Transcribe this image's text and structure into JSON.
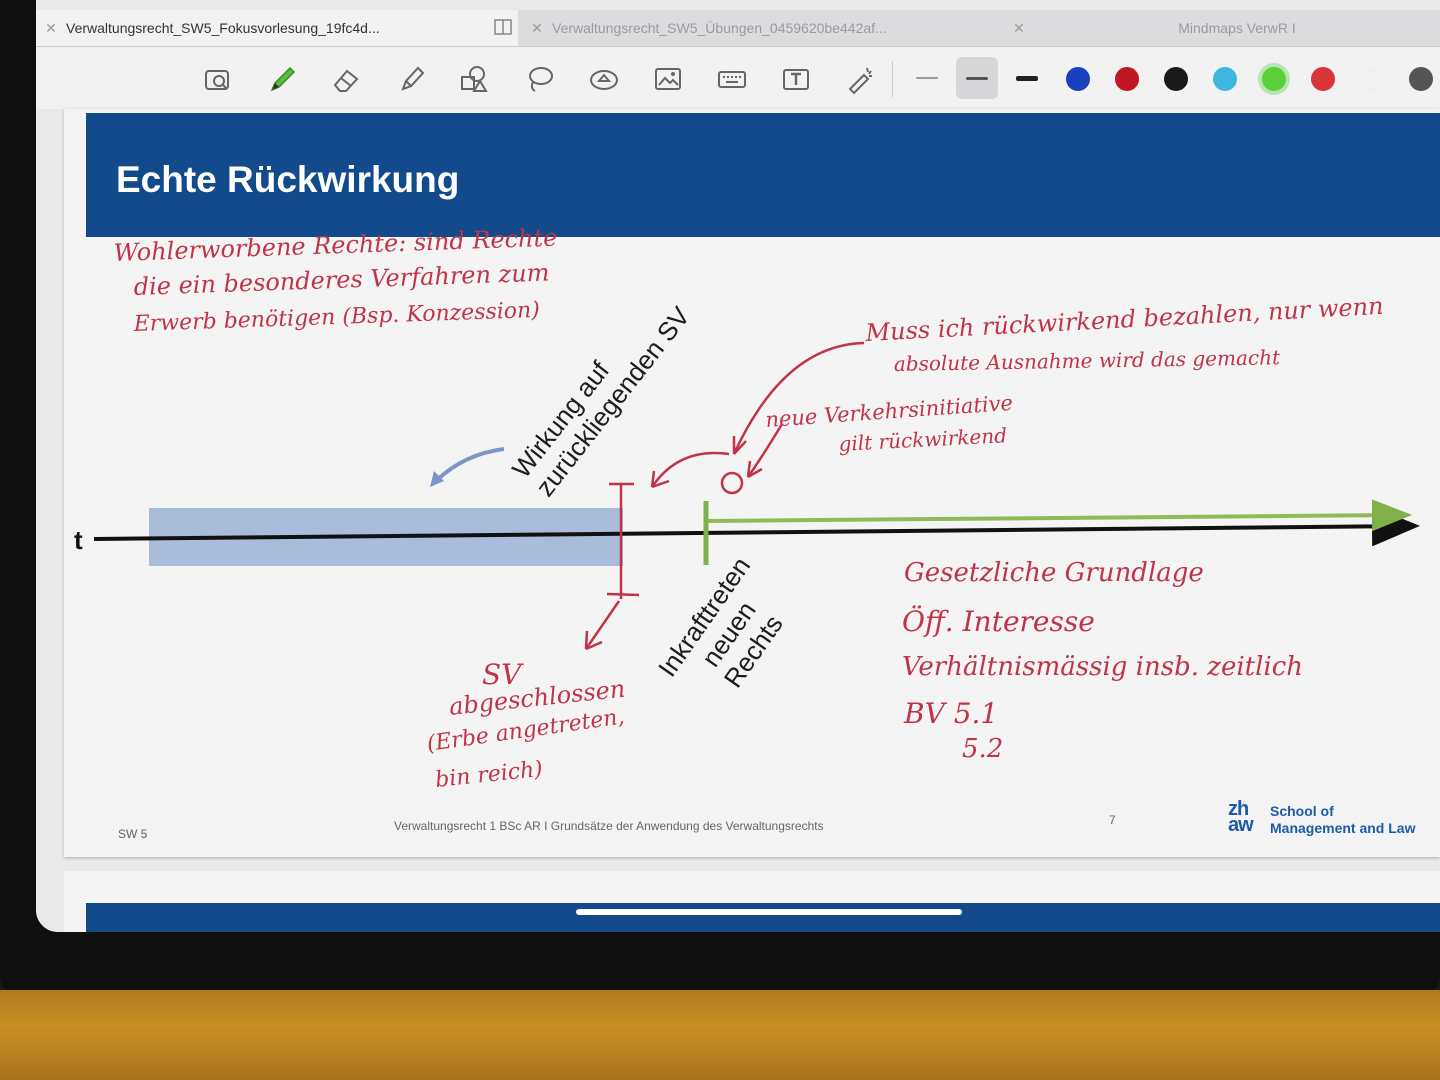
{
  "tabs": [
    {
      "label": "Verwaltungsrecht_SW5_Fokusvorlesung_19fc4d...",
      "active": true
    },
    {
      "label": "Verwaltungsrecht_SW5_Übungen_0459620be442af...",
      "active": false
    },
    {
      "label": "Mindmaps VerwR I",
      "active": false
    }
  ],
  "toolbar": {
    "tools": [
      "lasso-zoom-icon",
      "pen-icon",
      "eraser-icon",
      "highlighter-icon",
      "shapes-icon",
      "lasso-icon",
      "stamp-icon",
      "image-icon",
      "keyboard-icon",
      "text-box-icon",
      "laser-pointer-icon"
    ],
    "colors": [
      "#1a3fbf",
      "#c01622",
      "#1a1a1a",
      "#3fb6e0",
      "#5bd03a",
      "#d9343b",
      "#f0f0f0",
      "#555555"
    ],
    "selected_color": "#5bd03a"
  },
  "slide": {
    "title": "Echte Rückwirkung",
    "axis_label": "t",
    "label_effect": [
      "Wirkung auf",
      "zurückliegenden SV"
    ],
    "label_inkraft": [
      "Inkrafttreten",
      "neuen",
      "Rechts"
    ],
    "footer_left": "SW 5",
    "footer_center": "Verwaltungsrecht 1 BSc AR I Grundsätze der Anwendung des Verwaltungsrechts",
    "page_number": "7",
    "logo_mark": [
      "zh",
      "aw"
    ],
    "logo_text": [
      "School of",
      "Management and Law"
    ]
  },
  "annotations": {
    "top_left": [
      "Wohlerworbene Rechte: sind Rechte",
      "die ein besonderes Verfahren zum",
      "Erwerb benötigen (Bsp. Konzession)"
    ],
    "top_right": [
      "Muss ich rückwirkend bezahlen, nur wenn",
      "absolute Ausnahme wird das gemacht"
    ],
    "middle": [
      "neue Verkehrsinitiative",
      "gilt rückwirkend"
    ],
    "left_below": [
      "SV",
      "abgeschlossen",
      "(Erbe angetreten,",
      "bin reich)"
    ],
    "right_list": [
      "Gesetzliche Grundlage",
      "Öff. Interesse",
      "Verhältnismässig insb. zeitlich",
      "BV 5.1",
      "5.2"
    ]
  }
}
